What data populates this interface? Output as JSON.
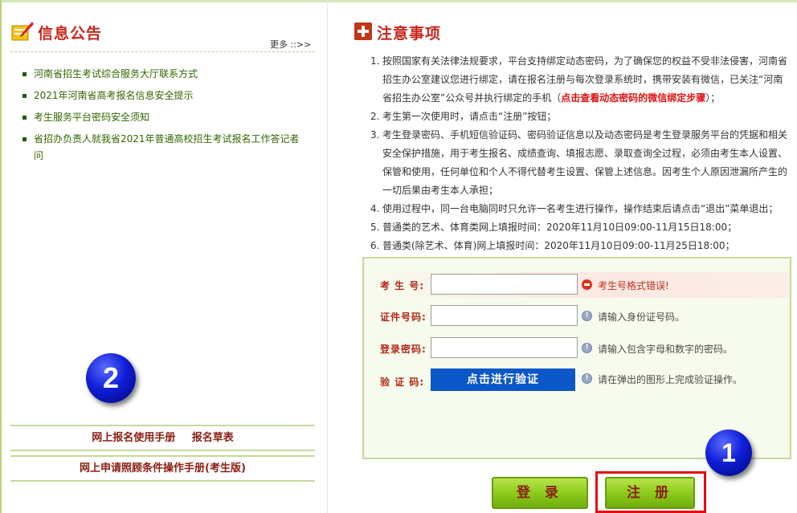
{
  "news": {
    "title": "信息公告",
    "more": "更多 ::>>",
    "items": [
      "河南省招生考试综合服务大厅联系方式",
      "2021年河南省高考报名信息安全提示",
      "考生服务平台密码安全须知",
      "省招办负责人就我省2021年普通高校招生考试报名工作答记者问"
    ]
  },
  "badges": {
    "two": "2",
    "one": "1"
  },
  "manuals": {
    "manual_link": "网上报名使用手册",
    "form_link": "报名草表",
    "photo_manual": "网上申请照顾条件操作手册(考生版)"
  },
  "notice": {
    "title": "注意事项",
    "items": [
      {
        "num": "1.",
        "text": "按照国家有关法律法规要求，平台支持绑定动态密码，为了确保您的权益不受非法侵害，河南省招生办公室建议您进行绑定，请在报名注册与每次登录系统时，携带安装有微信，已关注“河南省招生办公室”公众号并执行绑定的手机（",
        "link": "点击查看动态密码的微信绑定步骤",
        "tail": "）；"
      },
      {
        "num": "2.",
        "text": "考生第一次使用时，请点击“注册”按钮；"
      },
      {
        "num": "3.",
        "text": "考生登录密码、手机短信验证码、密码验证信息以及动态密码是考生登录服务平台的凭据和相关安全保护措施，用于考生报名、成绩查询、填报志愿、录取查询全过程，必须由考生本人设置、保管和使用，任何单位和个人不得代替考生设置、保管上述信息。因考生个人原因泄漏所产生的一切后果由考生本人承担；"
      },
      {
        "num": "4.",
        "text": "使用过程中，同一台电脑同时只允许一名考生进行操作，操作结束后请点击“退出”菜单退出；"
      },
      {
        "num": "5.",
        "text": "普通类的艺术、体育类网上填报时间：2020年11月10日09:00-11月15日18:00；"
      },
      {
        "num": "6.",
        "text": "普通类(除艺术、体育)网上填报时间：2020年11月10日09:00-11月25日18:00；"
      }
    ]
  },
  "form": {
    "exam_no": {
      "label": "考 生 号:",
      "value": "",
      "hint": "考生号格式错误!"
    },
    "id_no": {
      "label": "证件号码:",
      "value": "",
      "hint": "请输入身份证号码。"
    },
    "password": {
      "label": "登录密码:",
      "value": "",
      "hint": "请输入包含字母和数字的密码。"
    },
    "captcha": {
      "label": "验 证 码:",
      "button": "点击进行验证",
      "hint": "请在弹出的图形上完成验证操作。"
    }
  },
  "actions": {
    "login": "登 录",
    "register": "注 册"
  },
  "colors": {
    "accent_red": "#c8261b",
    "green": "#8ecb1d",
    "verify_blue": "#0b57c7",
    "highlight": "#e60d10"
  }
}
